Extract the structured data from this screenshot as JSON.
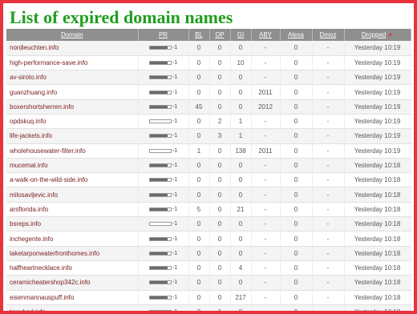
{
  "page": {
    "title": "List of expired domain names"
  },
  "table": {
    "headers": [
      "Domain",
      "PR",
      "BL",
      "DP",
      "GI",
      "ABY",
      "Alexa",
      "Dmoz",
      "Dropped"
    ],
    "rows": [
      {
        "domain": "nordieuchten.info",
        "pr_fill": 0.85,
        "bl": "0",
        "dp": "0",
        "gi": "0",
        "aby": "-",
        "alexa": "0",
        "dmoz": "-",
        "dropped": "Yesterday 10:19"
      },
      {
        "domain": "high-performance-save.info",
        "pr_fill": 0.85,
        "bl": "0",
        "dp": "0",
        "gi": "10",
        "aby": "-",
        "alexa": "0",
        "dmoz": "-",
        "dropped": "Yesterday 10:19"
      },
      {
        "domain": "av-siroto.info",
        "pr_fill": 0.85,
        "bl": "0",
        "dp": "0",
        "gi": "0",
        "aby": "-",
        "alexa": "0",
        "dmoz": "-",
        "dropped": "Yesterday 10:19"
      },
      {
        "domain": "guanzhuang.info",
        "pr_fill": 0.85,
        "bl": "0",
        "dp": "0",
        "gi": "0",
        "aby": "2011",
        "alexa": "0",
        "dmoz": "-",
        "dropped": "Yesterday 10:19"
      },
      {
        "domain": "boxershortsherren.info",
        "pr_fill": 0.85,
        "bl": "45",
        "dp": "0",
        "gi": "0",
        "aby": "2012",
        "alexa": "0",
        "dmoz": "-",
        "dropped": "Yesterday 10:19"
      },
      {
        "domain": "opdskuq.info",
        "pr_fill": 0.0,
        "bl": "0",
        "dp": "2",
        "gi": "1",
        "aby": "-",
        "alexa": "0",
        "dmoz": "-",
        "dropped": "Yesterday 10:19"
      },
      {
        "domain": "life-jackets.info",
        "pr_fill": 0.85,
        "bl": "0",
        "dp": "3",
        "gi": "1",
        "aby": "-",
        "alexa": "0",
        "dmoz": "-",
        "dropped": "Yesterday 10:19"
      },
      {
        "domain": "wholehousewater-filter.info",
        "pr_fill": 0.0,
        "bl": "1",
        "dp": "0",
        "gi": "138",
        "aby": "2011",
        "alexa": "0",
        "dmoz": "-",
        "dropped": "Yesterday 10:19"
      },
      {
        "domain": "mucemal.info",
        "pr_fill": 0.85,
        "bl": "0",
        "dp": "0",
        "gi": "0",
        "aby": "-",
        "alexa": "0",
        "dmoz": "-",
        "dropped": "Yesterday 10:18"
      },
      {
        "domain": "a-walk-on-the-wild-side.info",
        "pr_fill": 0.85,
        "bl": "0",
        "dp": "0",
        "gi": "0",
        "aby": "-",
        "alexa": "0",
        "dmoz": "-",
        "dropped": "Yesterday 10:18"
      },
      {
        "domain": "milosavljevic.info",
        "pr_fill": 0.85,
        "bl": "0",
        "dp": "0",
        "gi": "0",
        "aby": "-",
        "alexa": "0",
        "dmoz": "-",
        "dropped": "Yesterday 10:18"
      },
      {
        "domain": "arsflorida.info",
        "pr_fill": 0.85,
        "bl": "5",
        "dp": "0",
        "gi": "21",
        "aby": "-",
        "alexa": "0",
        "dmoz": "-",
        "dropped": "Yesterday 10:18"
      },
      {
        "domain": "bsreps.info",
        "pr_fill": 0.0,
        "bl": "0",
        "dp": "0",
        "gi": "0",
        "aby": "-",
        "alexa": "0",
        "dmoz": "-",
        "dropped": "Yesterday 10:18"
      },
      {
        "domain": "inchegente.info",
        "pr_fill": 0.85,
        "bl": "0",
        "dp": "0",
        "gi": "0",
        "aby": "-",
        "alexa": "0",
        "dmoz": "-",
        "dropped": "Yesterday 10:18"
      },
      {
        "domain": "laketarponwaterfronthomes.info",
        "pr_fill": 0.85,
        "bl": "0",
        "dp": "0",
        "gi": "0",
        "aby": "-",
        "alexa": "0",
        "dmoz": "-",
        "dropped": "Yesterday 10:18"
      },
      {
        "domain": "halfheartnecklace.info",
        "pr_fill": 0.85,
        "bl": "0",
        "dp": "0",
        "gi": "4",
        "aby": "-",
        "alexa": "0",
        "dmoz": "-",
        "dropped": "Yesterday 10:18"
      },
      {
        "domain": "ceramicheatershop342c.info",
        "pr_fill": 0.85,
        "bl": "0",
        "dp": "0",
        "gi": "0",
        "aby": "-",
        "alexa": "0",
        "dmoz": "-",
        "dropped": "Yesterday 10:18"
      },
      {
        "domain": "eisenmannauspuff.info",
        "pr_fill": 0.85,
        "bl": "0",
        "dp": "0",
        "gi": "217",
        "aby": "-",
        "alexa": "0",
        "dmoz": "-",
        "dropped": "Yesterday 10:18"
      },
      {
        "domain": "taradrod.info",
        "pr_fill": 0.85,
        "bl": "0",
        "dp": "1",
        "gi": "0",
        "aby": "-",
        "alexa": "0",
        "dmoz": "-",
        "dropped": "Yesterday 10:18"
      }
    ],
    "pr_label": "-1"
  },
  "icons": {
    "sort": "sort-down-icon"
  },
  "colors": {
    "frame": "#e8323c",
    "title": "#1f9e1f",
    "header": "#8f8f8f",
    "link": "#7a2020"
  }
}
